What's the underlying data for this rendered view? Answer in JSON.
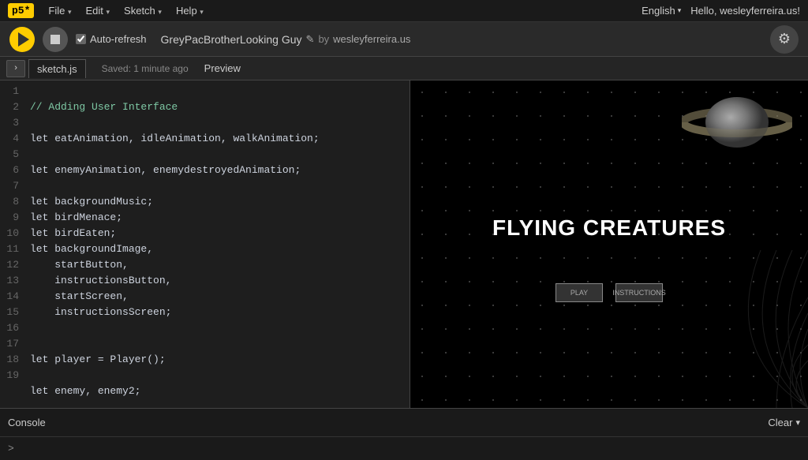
{
  "topbar": {
    "logo": "p5*",
    "menu": [
      "File",
      "Edit",
      "Sketch",
      "Help"
    ],
    "menu_arrows": [
      "▾",
      "▾",
      "▾",
      "▾"
    ],
    "lang": "English",
    "lang_arrow": "▾",
    "user_greeting": "Hello, wesleyferreira.us!"
  },
  "toolbar": {
    "play_title": "play",
    "stop_title": "stop",
    "auto_refresh_label": "Auto-refresh",
    "sketch_name": "GreyPacBrotherLooking Guy",
    "edit_icon": "✎",
    "by_text": "by",
    "author": "wesleyferreira.us",
    "settings_icon": "⚙"
  },
  "filetab": {
    "collapse_arrow": "›",
    "filename": "sketch.js",
    "saved_status": "Saved: 1 minute ago",
    "preview_label": "Preview"
  },
  "code": {
    "lines": [
      {
        "n": 1,
        "text": "// Adding User Interface",
        "type": "comment"
      },
      {
        "n": 2,
        "text": "",
        "type": "text"
      },
      {
        "n": 3,
        "text": "let eatAnimation, idleAnimation, walkAnimation;",
        "type": "text"
      },
      {
        "n": 4,
        "text": "",
        "type": "text"
      },
      {
        "n": 5,
        "text": "let enemyAnimation, enemydestroyedAnimation;",
        "type": "text"
      },
      {
        "n": 6,
        "text": "",
        "type": "text"
      },
      {
        "n": 7,
        "text": "let backgroundMusic;",
        "type": "text"
      },
      {
        "n": 8,
        "text": "let birdMenace;",
        "type": "text"
      },
      {
        "n": 9,
        "text": "let birdEaten;",
        "type": "text"
      },
      {
        "n": 10,
        "text": "let backgroundImage,",
        "type": "text"
      },
      {
        "n": 11,
        "text": "    startButton,",
        "type": "text"
      },
      {
        "n": 12,
        "text": "    instructionsButton,",
        "type": "text"
      },
      {
        "n": 13,
        "text": "    startScreen,",
        "type": "text"
      },
      {
        "n": 14,
        "text": "    instructionsScreen;",
        "type": "text"
      },
      {
        "n": 15,
        "text": "",
        "type": "text"
      },
      {
        "n": 16,
        "text": "",
        "type": "text"
      },
      {
        "n": 17,
        "text": "let player = Player();",
        "type": "text"
      },
      {
        "n": 18,
        "text": "",
        "type": "text"
      },
      {
        "n": 19,
        "text": "let enemy, enemy2;",
        "type": "text"
      }
    ]
  },
  "preview": {
    "game_title": "FLYING CREATURES",
    "btn1_label": "PLAY",
    "btn2_label": "INSTRUCTIONS"
  },
  "console": {
    "label": "Console",
    "clear_label": "Clear",
    "clear_arrow": "▾",
    "prompt": ">"
  }
}
